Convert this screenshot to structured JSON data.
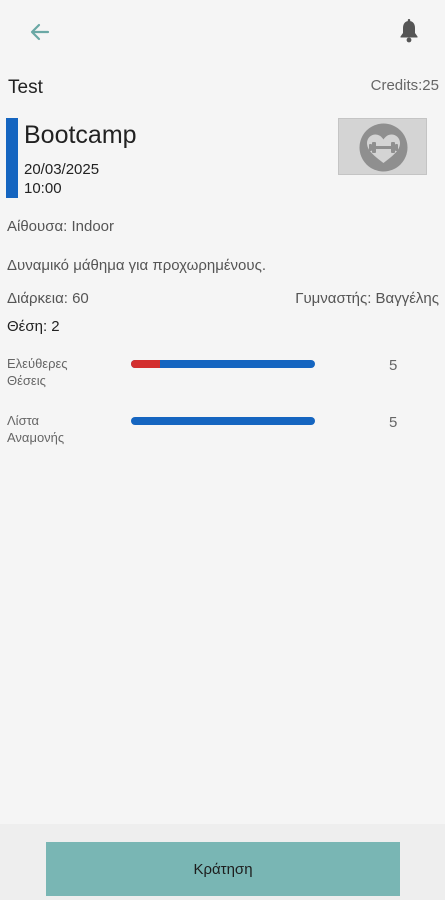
{
  "toolbar": {
    "back_icon": "arrow-left-icon",
    "back_icon_color": "#6aa8a5",
    "bell_icon": "bell-icon",
    "bell_icon_color": "#555555"
  },
  "header": {
    "user_name": "Test",
    "credits": "Credits:25"
  },
  "class": {
    "title": "Bootcamp",
    "date": "20/03/2025",
    "time": "10:00",
    "accent_color": "#1565c0",
    "image_icon": "heart-dumbbell-icon"
  },
  "details": {
    "room": "Αίθουσα: Indoor",
    "description": "Δυναμικό μάθημα για προχωρημένους.",
    "duration": "Διάρκεια: 60",
    "trainer": "Γυμναστής: Βαγγέλης",
    "position": "Θέση: 2"
  },
  "stats": [
    {
      "label_line1": "Ελεύθερες",
      "label_line2": "Θέσεις",
      "value": "5",
      "red_fraction": 0.16
    },
    {
      "label_line1": "Λίστα",
      "label_line2": "Αναμονής",
      "value": "5",
      "red_fraction": 0
    }
  ],
  "colors": {
    "bar_blue": "#1565c0",
    "bar_red": "#d32f2f",
    "button_bg": "#79b6b4"
  },
  "actions": {
    "book_label": "Κράτηση"
  }
}
